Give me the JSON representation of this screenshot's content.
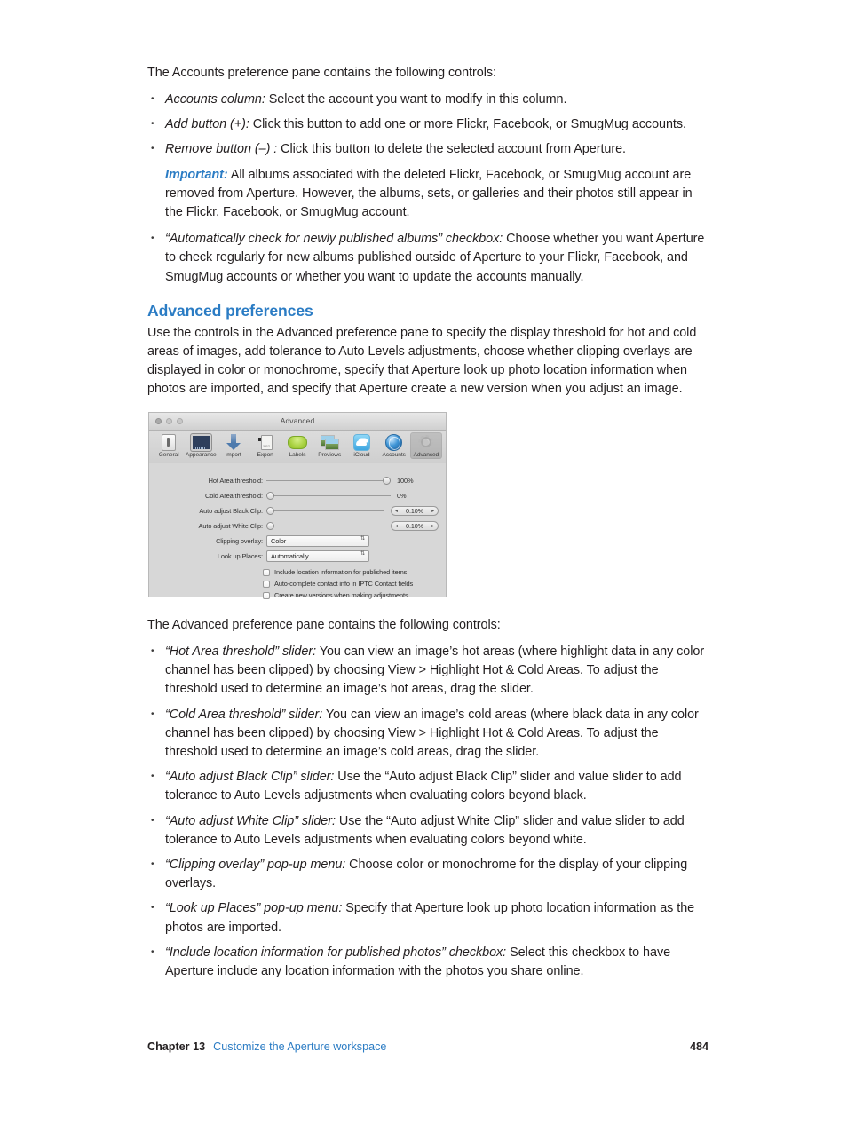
{
  "intro": {
    "accounts_lead": "The Accounts preference pane contains the following controls:"
  },
  "accounts_bullets": [
    {
      "term": "Accounts column:",
      "text": " Select the account you want to modify in this column."
    },
    {
      "term": "Add button (+):",
      "text": " Click this button to add one or more Flickr, Facebook, or SmugMug accounts."
    },
    {
      "term": "Remove button (–) :",
      "text": " Click this button to delete the selected account from Aperture."
    }
  ],
  "important": {
    "label": "Important:",
    "text": "  All albums associated with the deleted Flickr, Facebook, or SmugMug account are removed from Aperture. However, the albums, sets, or galleries and their photos still appear in the Flickr, Facebook, or SmugMug account."
  },
  "accounts_bullets_2": [
    {
      "term": "“Automatically check for newly published albums” checkbox:",
      "text": " Choose whether you want Aperture to check regularly for new albums published outside of Aperture to your Flickr, Facebook, and SmugMug accounts or whether you want to update the accounts manually."
    }
  ],
  "section": {
    "heading": "Advanced preferences",
    "heading_color": "#2b7cc4",
    "intro": "Use the controls in the Advanced preference pane to specify the display threshold for hot and cold areas of images, add tolerance to Auto Levels adjustments, choose whether clipping overlays are displayed in color or monochrome, specify that Aperture look up photo location information when photos are imported, and specify that Aperture create a new version when you adjust an image."
  },
  "figure": {
    "window_title": "Advanced",
    "traffic_lights": [
      "close-button",
      "minimize-button",
      "zoom-button"
    ],
    "toolbar": [
      {
        "label": "General",
        "icon": "general-icon",
        "selected": false
      },
      {
        "label": "Appearance",
        "icon": "appearance-icon",
        "selected": false
      },
      {
        "label": "Import",
        "icon": "import-icon",
        "selected": false
      },
      {
        "label": "Export",
        "icon": "export-icon",
        "selected": false
      },
      {
        "label": "Labels",
        "icon": "labels-icon",
        "selected": false
      },
      {
        "label": "Previews",
        "icon": "previews-icon",
        "selected": false
      },
      {
        "label": "iCloud",
        "icon": "icloud-icon",
        "selected": false
      },
      {
        "label": "Accounts",
        "icon": "accounts-icon",
        "selected": false
      },
      {
        "label": "Advanced",
        "icon": "advanced-icon",
        "selected": true
      }
    ],
    "sliders": [
      {
        "label": "Hot Area threshold:",
        "value": "100%",
        "percent": 100
      },
      {
        "label": "Cold Area threshold:",
        "value": "0%",
        "percent": 0
      }
    ],
    "steppers": [
      {
        "label": "Auto adjust Black Clip:",
        "value": "0.10%",
        "percent": 0
      },
      {
        "label": "Auto adjust White Clip:",
        "value": "0.10%",
        "percent": 0
      }
    ],
    "popups": [
      {
        "label": "Clipping overlay:",
        "value": "Color"
      },
      {
        "label": "Look up Places:",
        "value": "Automatically"
      }
    ],
    "checkboxes": [
      {
        "label": "Include location information for published items",
        "checked": false
      },
      {
        "label": "Auto-complete contact info in IPTC Contact fields",
        "checked": false
      },
      {
        "label": "Create new versions when making adjustments",
        "checked": false
      }
    ]
  },
  "advanced_lead": "The Advanced preference pane contains the following controls:",
  "advanced_bullets": [
    {
      "term": "“Hot Area threshold” slider:",
      "text": " You can view an image’s hot areas (where highlight data in any color channel has been clipped) by choosing View > Highlight Hot & Cold Areas. To adjust the threshold used to determine an image’s hot areas, drag the slider."
    },
    {
      "term": "“Cold Area threshold” slider:",
      "text": " You can view an image’s cold areas (where black data in any color channel has been clipped) by choosing View > Highlight Hot & Cold Areas. To adjust the threshold used to determine an image’s cold areas, drag the slider."
    },
    {
      "term": "“Auto adjust Black Clip” slider:",
      "text": " Use the “Auto adjust Black Clip” slider and value slider to add tolerance to Auto Levels adjustments when evaluating colors beyond black."
    },
    {
      "term": "“Auto adjust White Clip” slider:",
      "text": " Use the “Auto adjust White Clip” slider and value slider to add tolerance to Auto Levels adjustments when evaluating colors beyond white."
    },
    {
      "term": "“Clipping overlay” pop-up menu:",
      "text": " Choose color or monochrome for the display of your clipping overlays."
    },
    {
      "term": "“Look up Places” pop-up menu:",
      "text": " Specify that Aperture look up photo location information as the photos are imported."
    },
    {
      "term": "“Include location information for published photos” checkbox:",
      "text": " Select this checkbox to have Aperture include any location information with the photos you share online."
    }
  ],
  "footer": {
    "chapter": "Chapter 13",
    "chapter_title": "Customize the Aperture workspace",
    "page_number": "484"
  }
}
